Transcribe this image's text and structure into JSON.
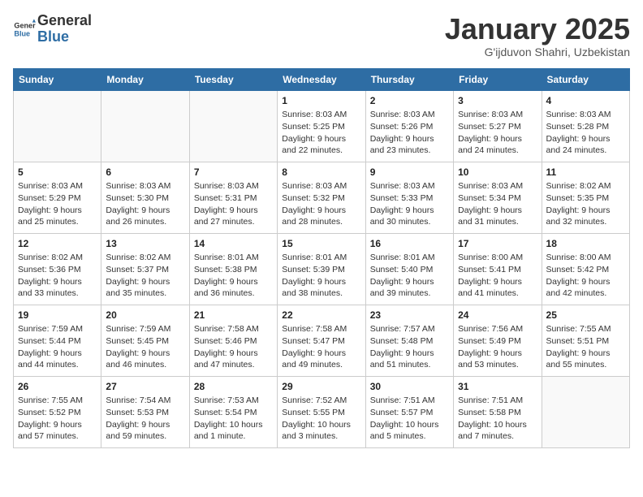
{
  "header": {
    "logo_line1": "General",
    "logo_line2": "Blue",
    "month_title": "January 2025",
    "subtitle": "G'ijduvon Shahri, Uzbekistan"
  },
  "weekdays": [
    "Sunday",
    "Monday",
    "Tuesday",
    "Wednesday",
    "Thursday",
    "Friday",
    "Saturday"
  ],
  "weeks": [
    [
      {
        "day": "",
        "info": ""
      },
      {
        "day": "",
        "info": ""
      },
      {
        "day": "",
        "info": ""
      },
      {
        "day": "1",
        "info": "Sunrise: 8:03 AM\nSunset: 5:25 PM\nDaylight: 9 hours\nand 22 minutes."
      },
      {
        "day": "2",
        "info": "Sunrise: 8:03 AM\nSunset: 5:26 PM\nDaylight: 9 hours\nand 23 minutes."
      },
      {
        "day": "3",
        "info": "Sunrise: 8:03 AM\nSunset: 5:27 PM\nDaylight: 9 hours\nand 24 minutes."
      },
      {
        "day": "4",
        "info": "Sunrise: 8:03 AM\nSunset: 5:28 PM\nDaylight: 9 hours\nand 24 minutes."
      }
    ],
    [
      {
        "day": "5",
        "info": "Sunrise: 8:03 AM\nSunset: 5:29 PM\nDaylight: 9 hours\nand 25 minutes."
      },
      {
        "day": "6",
        "info": "Sunrise: 8:03 AM\nSunset: 5:30 PM\nDaylight: 9 hours\nand 26 minutes."
      },
      {
        "day": "7",
        "info": "Sunrise: 8:03 AM\nSunset: 5:31 PM\nDaylight: 9 hours\nand 27 minutes."
      },
      {
        "day": "8",
        "info": "Sunrise: 8:03 AM\nSunset: 5:32 PM\nDaylight: 9 hours\nand 28 minutes."
      },
      {
        "day": "9",
        "info": "Sunrise: 8:03 AM\nSunset: 5:33 PM\nDaylight: 9 hours\nand 30 minutes."
      },
      {
        "day": "10",
        "info": "Sunrise: 8:03 AM\nSunset: 5:34 PM\nDaylight: 9 hours\nand 31 minutes."
      },
      {
        "day": "11",
        "info": "Sunrise: 8:02 AM\nSunset: 5:35 PM\nDaylight: 9 hours\nand 32 minutes."
      }
    ],
    [
      {
        "day": "12",
        "info": "Sunrise: 8:02 AM\nSunset: 5:36 PM\nDaylight: 9 hours\nand 33 minutes."
      },
      {
        "day": "13",
        "info": "Sunrise: 8:02 AM\nSunset: 5:37 PM\nDaylight: 9 hours\nand 35 minutes."
      },
      {
        "day": "14",
        "info": "Sunrise: 8:01 AM\nSunset: 5:38 PM\nDaylight: 9 hours\nand 36 minutes."
      },
      {
        "day": "15",
        "info": "Sunrise: 8:01 AM\nSunset: 5:39 PM\nDaylight: 9 hours\nand 38 minutes."
      },
      {
        "day": "16",
        "info": "Sunrise: 8:01 AM\nSunset: 5:40 PM\nDaylight: 9 hours\nand 39 minutes."
      },
      {
        "day": "17",
        "info": "Sunrise: 8:00 AM\nSunset: 5:41 PM\nDaylight: 9 hours\nand 41 minutes."
      },
      {
        "day": "18",
        "info": "Sunrise: 8:00 AM\nSunset: 5:42 PM\nDaylight: 9 hours\nand 42 minutes."
      }
    ],
    [
      {
        "day": "19",
        "info": "Sunrise: 7:59 AM\nSunset: 5:44 PM\nDaylight: 9 hours\nand 44 minutes."
      },
      {
        "day": "20",
        "info": "Sunrise: 7:59 AM\nSunset: 5:45 PM\nDaylight: 9 hours\nand 46 minutes."
      },
      {
        "day": "21",
        "info": "Sunrise: 7:58 AM\nSunset: 5:46 PM\nDaylight: 9 hours\nand 47 minutes."
      },
      {
        "day": "22",
        "info": "Sunrise: 7:58 AM\nSunset: 5:47 PM\nDaylight: 9 hours\nand 49 minutes."
      },
      {
        "day": "23",
        "info": "Sunrise: 7:57 AM\nSunset: 5:48 PM\nDaylight: 9 hours\nand 51 minutes."
      },
      {
        "day": "24",
        "info": "Sunrise: 7:56 AM\nSunset: 5:49 PM\nDaylight: 9 hours\nand 53 minutes."
      },
      {
        "day": "25",
        "info": "Sunrise: 7:55 AM\nSunset: 5:51 PM\nDaylight: 9 hours\nand 55 minutes."
      }
    ],
    [
      {
        "day": "26",
        "info": "Sunrise: 7:55 AM\nSunset: 5:52 PM\nDaylight: 9 hours\nand 57 minutes."
      },
      {
        "day": "27",
        "info": "Sunrise: 7:54 AM\nSunset: 5:53 PM\nDaylight: 9 hours\nand 59 minutes."
      },
      {
        "day": "28",
        "info": "Sunrise: 7:53 AM\nSunset: 5:54 PM\nDaylight: 10 hours\nand 1 minute."
      },
      {
        "day": "29",
        "info": "Sunrise: 7:52 AM\nSunset: 5:55 PM\nDaylight: 10 hours\nand 3 minutes."
      },
      {
        "day": "30",
        "info": "Sunrise: 7:51 AM\nSunset: 5:57 PM\nDaylight: 10 hours\nand 5 minutes."
      },
      {
        "day": "31",
        "info": "Sunrise: 7:51 AM\nSunset: 5:58 PM\nDaylight: 10 hours\nand 7 minutes."
      },
      {
        "day": "",
        "info": ""
      }
    ]
  ]
}
